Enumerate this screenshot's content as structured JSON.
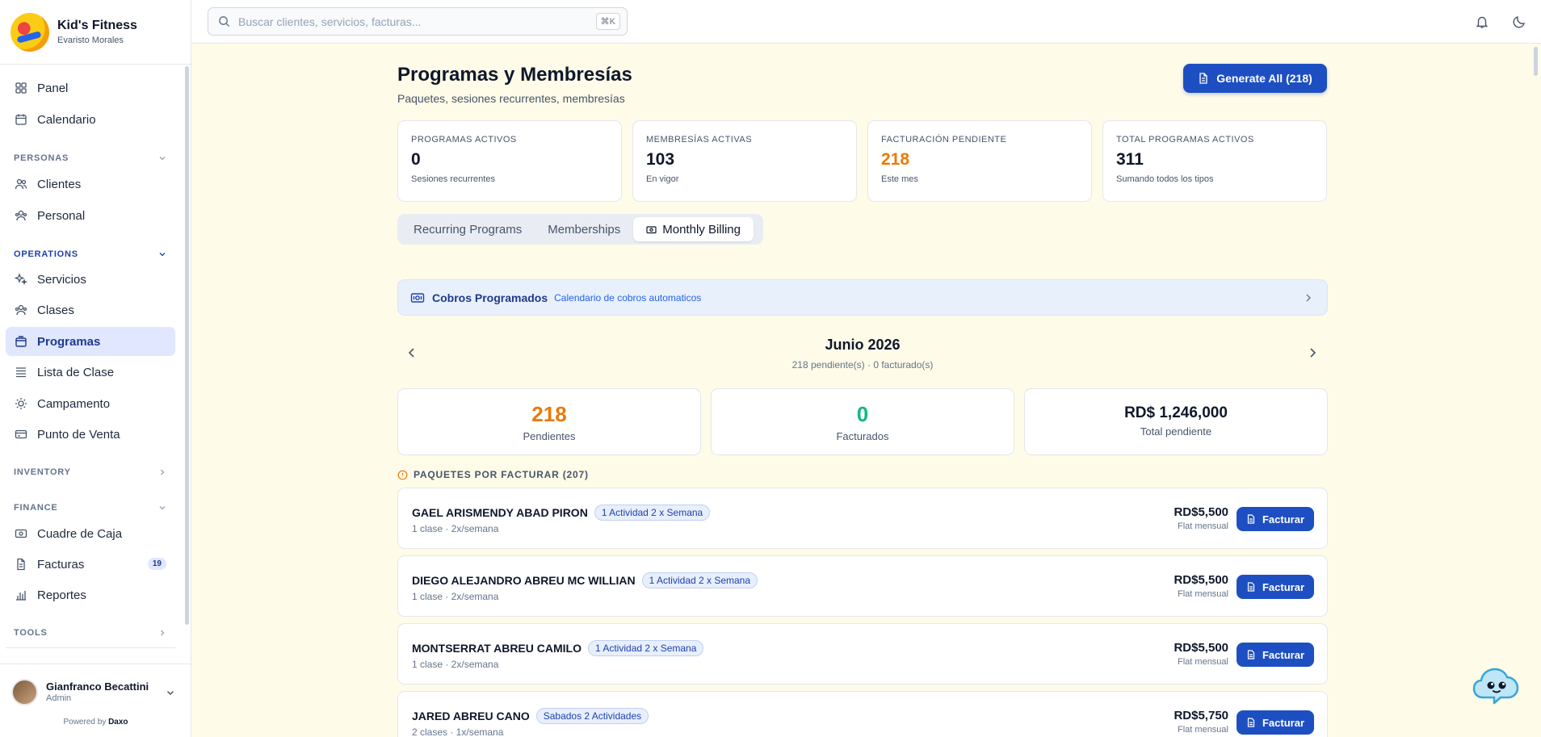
{
  "brand": {
    "name": "Kid's Fitness",
    "subtitle": "Evaristo Morales"
  },
  "sidebar": {
    "items": [
      {
        "label": "Panel",
        "icon": "grid-icon"
      },
      {
        "label": "Calendario",
        "icon": "calendar-icon"
      },
      {
        "label": "Clientes",
        "icon": "users-icon"
      },
      {
        "label": "Personal",
        "icon": "user-group-icon"
      },
      {
        "label": "Servicios",
        "icon": "sparkles-icon"
      },
      {
        "label": "Clases",
        "icon": "users-icon"
      },
      {
        "label": "Programas",
        "icon": "package-icon",
        "active": true
      },
      {
        "label": "Lista de Clase",
        "icon": "list-icon"
      },
      {
        "label": "Campamento",
        "icon": "sun-icon"
      },
      {
        "label": "Punto de Venta",
        "icon": "credit-card-icon"
      },
      {
        "label": "Cuadre de Caja",
        "icon": "cash-icon"
      },
      {
        "label": "Facturas",
        "icon": "file-icon",
        "badge": "19"
      },
      {
        "label": "Reportes",
        "icon": "bar-chart-icon"
      }
    ],
    "sections": {
      "personas": "PERSONAS",
      "operations": "OPERATIONS",
      "inventory": "INVENTORY",
      "finance": "FINANCE",
      "tools": "TOOLS"
    }
  },
  "user": {
    "name": "Gianfranco Becattini",
    "role": "Admin",
    "powered_prefix": "Powered by",
    "powered_brand": "Daxo"
  },
  "search": {
    "placeholder": "Buscar clientes, servicios, facturas...",
    "shortcut": "⌘K"
  },
  "page": {
    "title": "Programas y Membresías",
    "subtitle": "Paquetes, sesiones recurrentes, membresías",
    "generate_label": "Generate All (218)"
  },
  "stats": [
    {
      "label": "PROGRAMAS ACTIVOS",
      "value": "0",
      "sub": "Sesiones recurrentes",
      "color": "#0f172a"
    },
    {
      "label": "MEMBRESÍAS ACTIVAS",
      "value": "103",
      "sub": "En vigor",
      "color": "#0f172a"
    },
    {
      "label": "FACTURACIÓN PENDIENTE",
      "value": "218",
      "sub": "Este mes",
      "color": "#ea7a0a"
    },
    {
      "label": "TOTAL PROGRAMAS ACTIVOS",
      "value": "311",
      "sub": "Sumando todos los tipos",
      "color": "#0f172a"
    }
  ],
  "tabs": [
    {
      "label": "Recurring Programs"
    },
    {
      "label": "Memberships"
    },
    {
      "label": "Monthly Billing",
      "active": true
    }
  ],
  "cobros": {
    "title": "Cobros Programados",
    "subtitle": "Calendario de cobros automaticos"
  },
  "month": {
    "title": "Junio 2026",
    "subtitle": "218 pendiente(s) · 0 facturado(s)"
  },
  "summary": [
    {
      "value": "218",
      "label": "Pendientes"
    },
    {
      "value": "0",
      "label": "Facturados"
    },
    {
      "value": "RD$ 1,246,000",
      "label": "Total pendiente"
    }
  ],
  "packages": {
    "heading": "PAQUETES POR FACTURAR (207)",
    "button_label": "Facturar",
    "rows": [
      {
        "name": "GAEL ARISMENDY ABAD PIRON",
        "tag": "1 Actividad 2 x Semana",
        "sub": "1 clase · 2x/semana",
        "amount": "RD$5,500",
        "period": "Flat mensual"
      },
      {
        "name": "DIEGO ALEJANDRO ABREU MC WILLIAN",
        "tag": "1 Actividad 2 x Semana",
        "sub": "1 clase · 2x/semana",
        "amount": "RD$5,500",
        "period": "Flat mensual"
      },
      {
        "name": "MONTSERRAT ABREU CAMILO",
        "tag": "1 Actividad 2 x Semana",
        "sub": "1 clase · 2x/semana",
        "amount": "RD$5,500",
        "period": "Flat mensual"
      },
      {
        "name": "JARED ABREU CANO",
        "tag": "Sabados 2 Actividades",
        "sub": "2 clases · 1x/semana",
        "amount": "RD$5,750",
        "period": "Flat mensual"
      }
    ]
  },
  "colors": {
    "accent": "#1e4fc2",
    "pending": "#ea7a0a",
    "done": "#10b981",
    "background": "#fefbe8"
  }
}
